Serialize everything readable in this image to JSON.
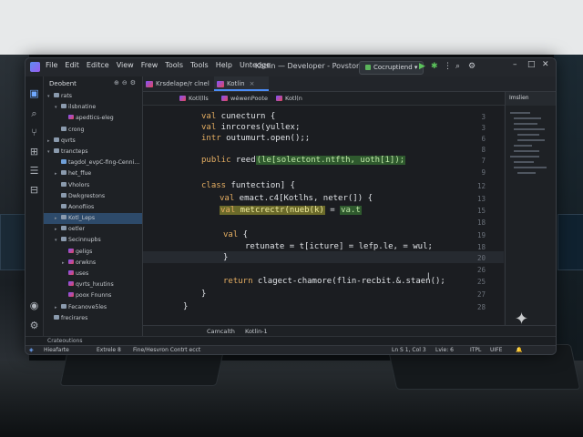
{
  "window": {
    "title": "Kotlin — Developer - Povstor1",
    "menu": [
      "File",
      "Edit",
      "Editce",
      "View",
      "Frew",
      "Tools",
      "Tools",
      "Help",
      "Untedge"
    ],
    "run_config": "Cocruptiend"
  },
  "project_panel": {
    "title": "Deobent",
    "items": [
      {
        "label": "rats",
        "indent": 0,
        "arrow": "▾",
        "icon": "folder"
      },
      {
        "label": "ilsbnatine",
        "indent": 1,
        "arrow": "▾",
        "icon": "folder"
      },
      {
        "label": "apedtics-eleg",
        "indent": 2,
        "arrow": "",
        "icon": "kt"
      },
      {
        "label": "crong",
        "indent": 1,
        "arrow": "",
        "icon": "folder"
      },
      {
        "label": "qvrts",
        "indent": 0,
        "arrow": "▸",
        "icon": "folder"
      },
      {
        "label": "trancteps",
        "indent": 0,
        "arrow": "▾",
        "icon": "folder"
      },
      {
        "label": "tagdol_evpC-fing-Cenni...",
        "indent": 1,
        "arrow": "",
        "icon": "file"
      },
      {
        "label": "het_ffue",
        "indent": 1,
        "arrow": "▸",
        "icon": "folder"
      },
      {
        "label": "Vholors",
        "indent": 1,
        "arrow": "",
        "icon": "folder"
      },
      {
        "label": "Dwkgrestons",
        "indent": 1,
        "arrow": "",
        "icon": "folder"
      },
      {
        "label": "Aonofiios",
        "indent": 1,
        "arrow": "",
        "icon": "folder"
      },
      {
        "label": "Kotl_Leps",
        "indent": 1,
        "arrow": "▸",
        "icon": "folder",
        "selected": true
      },
      {
        "label": "oetler",
        "indent": 1,
        "arrow": "▸",
        "icon": "folder"
      },
      {
        "label": "Secinnupbs",
        "indent": 1,
        "arrow": "▾",
        "icon": "folder"
      },
      {
        "label": "geligs",
        "indent": 2,
        "arrow": "",
        "icon": "kt"
      },
      {
        "label": "orwkns",
        "indent": 2,
        "arrow": "▸",
        "icon": "kt"
      },
      {
        "label": "uses",
        "indent": 2,
        "arrow": "",
        "icon": "kt"
      },
      {
        "label": "qvrts_hxutins",
        "indent": 2,
        "arrow": "",
        "icon": "kt"
      },
      {
        "label": "poox Fnunns",
        "indent": 2,
        "arrow": "",
        "icon": "kt"
      },
      {
        "label": "Fecanove5les",
        "indent": 1,
        "arrow": "▸",
        "icon": "folder"
      },
      {
        "label": "frecirares",
        "indent": 0,
        "arrow": "",
        "icon": "folder"
      }
    ]
  },
  "tabs": [
    {
      "label": "Krsdelape/r clnel",
      "active": false
    },
    {
      "label": "Kotlin",
      "active": true
    }
  ],
  "subtabs": [
    "Kotl(lls",
    "wéwenPoote",
    "Kotl(n"
  ],
  "editor": {
    "lines": [
      {
        "n": "3",
        "text": "val cunecturn {"
      },
      {
        "n": "3",
        "text": "val inrcores(yullex;"
      },
      {
        "n": "6",
        "text": "intr outumurt.open();;"
      },
      {
        "n": "8",
        "text": ""
      },
      {
        "n": "7",
        "text": "public reed(le[solectont.ntfth, uoth[1]);"
      },
      {
        "n": "9",
        "text": ""
      },
      {
        "n": "12",
        "text": "class funtection] {"
      },
      {
        "n": "13",
        "text": "val emact.c4[Kotlhs, neter(]) {"
      },
      {
        "n": "15",
        "text": "val metcrectr(nueb(k) = va.t"
      },
      {
        "n": "18",
        "text": ""
      },
      {
        "n": "19",
        "text": "val {"
      },
      {
        "n": "18",
        "text": "retunate = t[icture] = lefp.le, = wul;"
      },
      {
        "n": "20",
        "text": "}"
      },
      {
        "n": "26",
        "text": ""
      },
      {
        "n": "25",
        "text": "return clagect-chamore(flin-recbit.&.staen();"
      },
      {
        "n": "27",
        "text": "}"
      },
      {
        "n": "28",
        "text": "}"
      }
    ]
  },
  "structure": {
    "title": "Imslien"
  },
  "bottom_tabs": [
    "Camcalth",
    "Kotlin-1"
  ],
  "run_panel": {
    "label": "Crateoutions",
    "items": [
      "Hieafarte",
      "Extrele 8",
      "Fine/Hesvron Contrt ecct"
    ]
  },
  "status": {
    "position": "Ln S 1, Col 3",
    "line": "Lvie: 6",
    "encoding": "ITPL",
    "eol": "UIFE"
  }
}
